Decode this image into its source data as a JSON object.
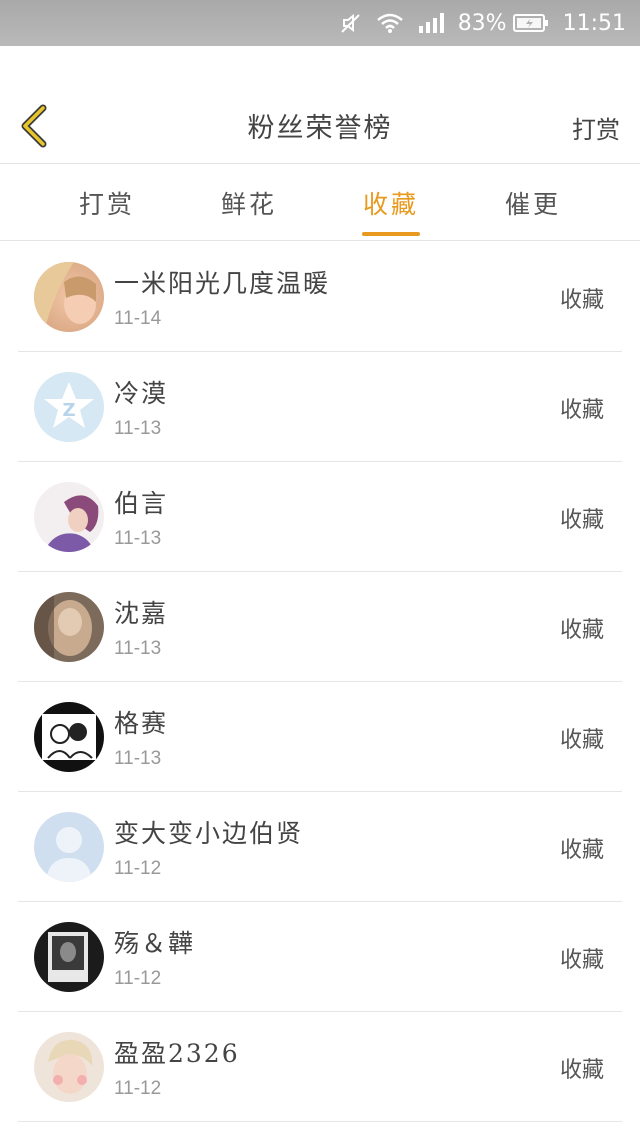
{
  "status_bar": {
    "battery_percent": "83%",
    "time": "11:51"
  },
  "header": {
    "title": "粉丝荣誉榜",
    "action": "打赏",
    "accent_color": "#e89a1f"
  },
  "tabs": [
    {
      "label": "打赏",
      "active": false
    },
    {
      "label": "鲜花",
      "active": false
    },
    {
      "label": "收藏",
      "active": true
    },
    {
      "label": "催更",
      "active": false
    }
  ],
  "fans": [
    {
      "name": "一米阳光几度温暖",
      "date": "11-14",
      "action": "收藏",
      "avatar": "photo-girl"
    },
    {
      "name": "冷漠",
      "date": "11-13",
      "action": "收藏",
      "avatar": "qzone-star"
    },
    {
      "name": "伯言",
      "date": "11-13",
      "action": "收藏",
      "avatar": "photo-purple"
    },
    {
      "name": "沈嘉",
      "date": "11-13",
      "action": "收藏",
      "avatar": "photo-brown"
    },
    {
      "name": "格赛",
      "date": "11-13",
      "action": "收藏",
      "avatar": "photo-sketch"
    },
    {
      "name": "变大变小边伯贤",
      "date": "11-12",
      "action": "收藏",
      "avatar": "default-user"
    },
    {
      "name": "殇＆韡",
      "date": "11-12",
      "action": "收藏",
      "avatar": "photo-dark"
    },
    {
      "name": "盈盈2326",
      "date": "11-12",
      "action": "收藏",
      "avatar": "photo-pink"
    }
  ]
}
